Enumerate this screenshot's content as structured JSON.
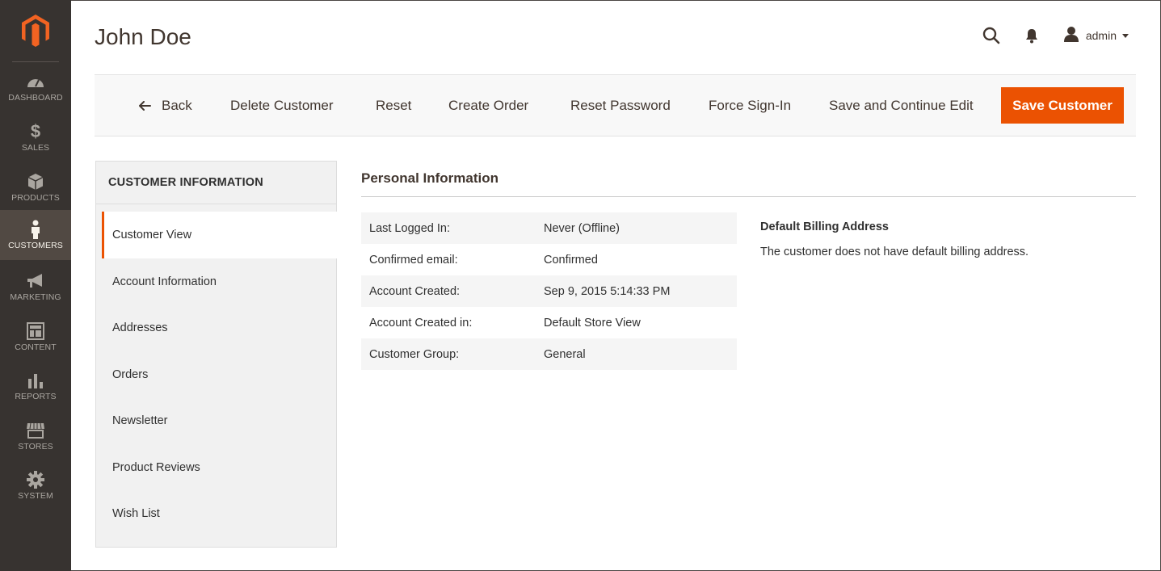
{
  "sidebar": {
    "logo": "magento-logo",
    "items": [
      {
        "label": "DASHBOARD",
        "icon": "dashboard-icon",
        "active": false
      },
      {
        "label": "SALES",
        "icon": "dollar-icon",
        "active": false
      },
      {
        "label": "PRODUCTS",
        "icon": "box-icon",
        "active": false
      },
      {
        "label": "CUSTOMERS",
        "icon": "person-icon",
        "active": true
      },
      {
        "label": "MARKETING",
        "icon": "megaphone-icon",
        "active": false
      },
      {
        "label": "CONTENT",
        "icon": "layout-icon",
        "active": false
      },
      {
        "label": "REPORTS",
        "icon": "bar-chart-icon",
        "active": false
      },
      {
        "label": "STORES",
        "icon": "storefront-icon",
        "active": false
      },
      {
        "label": "SYSTEM",
        "icon": "gear-icon",
        "active": false
      }
    ]
  },
  "header": {
    "title": "John Doe",
    "user": "admin"
  },
  "toolbar": {
    "back": "Back",
    "delete": "Delete Customer",
    "reset": "Reset",
    "create_order": "Create Order",
    "reset_password": "Reset Password",
    "force_signin": "Force Sign-In",
    "save_continue": "Save and Continue Edit",
    "save": "Save Customer"
  },
  "tabs": {
    "title": "CUSTOMER INFORMATION",
    "items": [
      {
        "label": "Customer View",
        "active": true
      },
      {
        "label": "Account Information",
        "active": false
      },
      {
        "label": "Addresses",
        "active": false
      },
      {
        "label": "Orders",
        "active": false
      },
      {
        "label": "Newsletter",
        "active": false
      },
      {
        "label": "Product Reviews",
        "active": false
      },
      {
        "label": "Wish List",
        "active": false
      }
    ]
  },
  "personal": {
    "title": "Personal Information",
    "rows": [
      {
        "label": "Last Logged In:",
        "value": "Never (Offline)"
      },
      {
        "label": "Confirmed email:",
        "value": "Confirmed"
      },
      {
        "label": "Account Created:",
        "value": "Sep 9, 2015 5:14:33 PM"
      },
      {
        "label": "Account Created in:",
        "value": "Default Store View"
      },
      {
        "label": "Customer Group:",
        "value": "General"
      }
    ]
  },
  "billing": {
    "title": "Default Billing Address",
    "text": "The customer does not have default billing address."
  },
  "colors": {
    "sidebar_bg": "#373330",
    "accent": "#eb5202"
  }
}
